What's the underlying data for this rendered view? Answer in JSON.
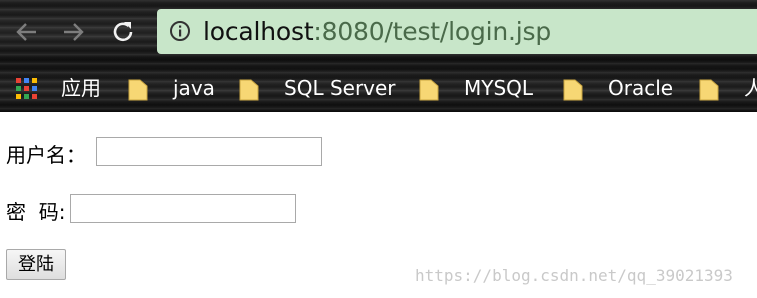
{
  "browser": {
    "url_host": "localhost",
    "url_rest": ":8080/test/login.jsp",
    "nav_icons": [
      "back-arrow-icon",
      "forward-arrow-icon",
      "reload-icon",
      "info-icon"
    ],
    "omnibox_color": "#c8e6c9",
    "bookmarks": [
      {
        "label": "应用",
        "icon": "apps-grid-icon"
      },
      {
        "label": "java",
        "icon": "folder-icon"
      },
      {
        "label": "SQL Server",
        "icon": "folder-icon"
      },
      {
        "label": "MYSQL",
        "icon": "folder-icon"
      },
      {
        "label": "Oracle",
        "icon": "folder-icon"
      },
      {
        "label": "人",
        "icon": "folder-icon"
      }
    ]
  },
  "form": {
    "username_label": "用户名：",
    "username_value": "",
    "password_label": "密  码:",
    "password_value": "",
    "submit_label": "登陆"
  },
  "watermark": "https://blog.csdn.net/qq_39021393"
}
